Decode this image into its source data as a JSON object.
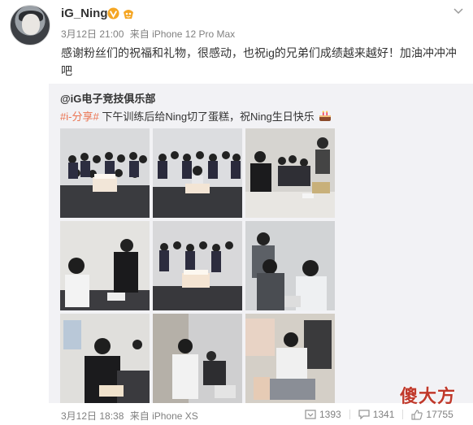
{
  "user": {
    "name": "iG_Ning",
    "time": "3月12日 21:00",
    "source": "来自 iPhone 12 Pro Max"
  },
  "post": {
    "text": "感谢粉丝们的祝福和礼物，很感动，也祝ig的兄弟们成绩越来越好！加油冲冲冲吧"
  },
  "repost": {
    "author": "@iG电子竞技俱乐部",
    "tag": "#i-分享#",
    "text": "下午训练后给Ning切了蛋糕，祝Ning生日快乐"
  },
  "repost_footer": {
    "time": "3月12日 18:38",
    "source": "来自 iPhone XS"
  },
  "stats": {
    "reposts": "1393",
    "comments": "1341",
    "likes": "17755"
  },
  "watermark": "傻大方",
  "colors": {
    "tag": "#eb7350",
    "verify": "#f5a623",
    "watermark": "#c0392b"
  }
}
